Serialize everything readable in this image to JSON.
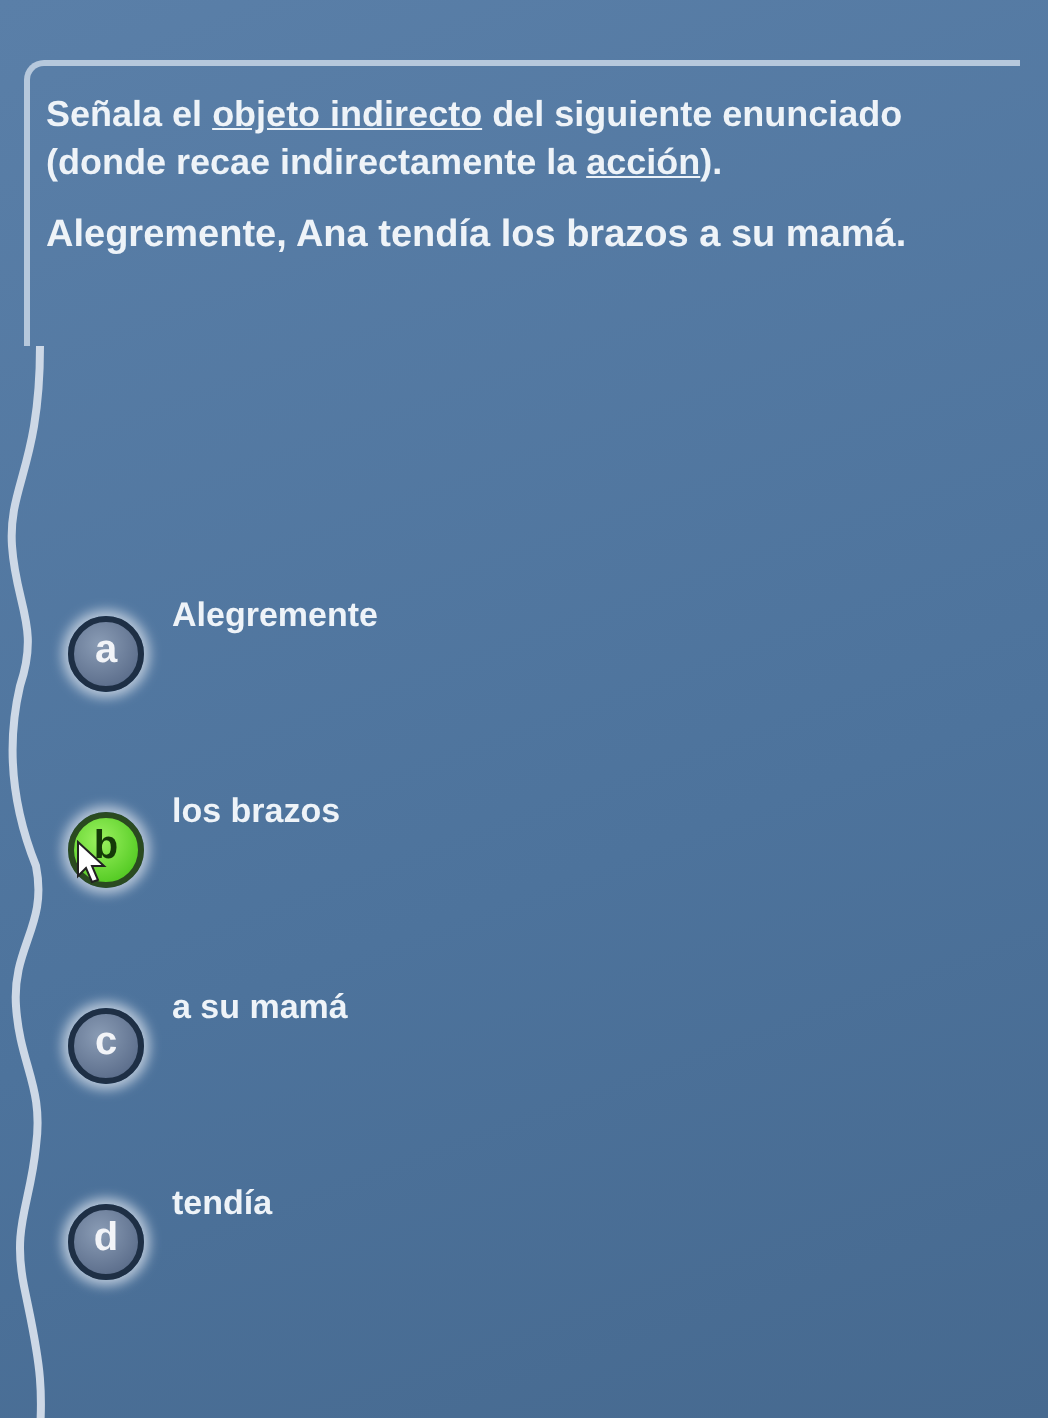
{
  "question": {
    "instruction": [
      {
        "text": "Señala el ",
        "underline": false
      },
      {
        "text": "objeto indirecto",
        "underline": true
      },
      {
        "text": " del siguiente enunciado (donde recae indirectamente la ",
        "underline": false
      },
      {
        "text": "acción",
        "underline": true
      },
      {
        "text": ").",
        "underline": false
      }
    ],
    "sentence": "Alegremente, Ana tendía los brazos a su mamá."
  },
  "options": [
    {
      "letter": "a",
      "text": "Alegremente",
      "selected": false
    },
    {
      "letter": "b",
      "text": "los brazos",
      "selected": true
    },
    {
      "letter": "c",
      "text": "a su mamá",
      "selected": false
    },
    {
      "letter": "d",
      "text": "tendía",
      "selected": false
    }
  ]
}
